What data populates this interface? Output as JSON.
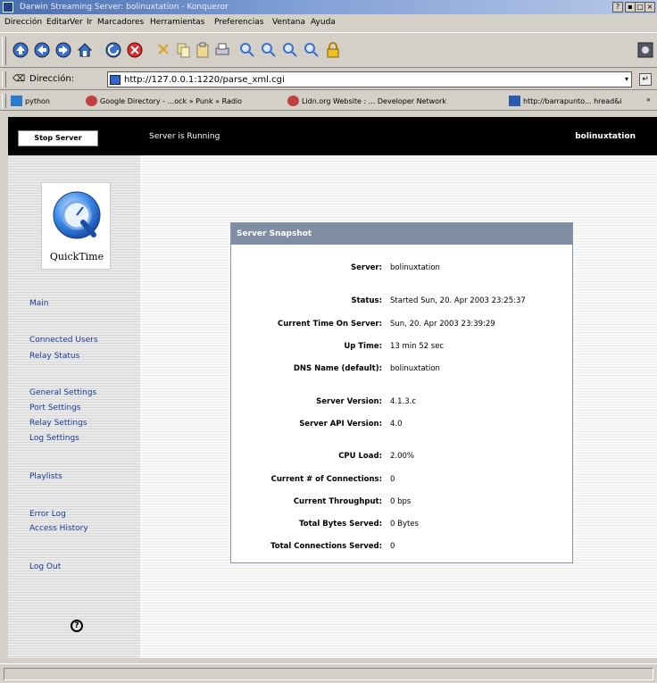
{
  "window": {
    "title": "Darwin Streaming Server: bolinuxtation - Konqueror"
  },
  "menu": [
    "Dirección",
    "Editar",
    "Ver",
    "Ir",
    "Marcadores",
    "Herramientas",
    "Preferencias",
    "Ventana",
    "Ayuda"
  ],
  "toolbar_icons": [
    "up-icon",
    "back-icon",
    "forward-icon",
    "home-icon",
    "reload-icon",
    "stop-icon",
    "cut-icon",
    "copy-icon",
    "paste-icon",
    "print-icon",
    "zoom-fit-icon",
    "zoom-in-icon",
    "zoom-out-icon",
    "zoom-icon",
    "lock-icon"
  ],
  "location": {
    "label": "Dirección:",
    "url": "http://127.0.0.1:1220/parse_xml.cgi"
  },
  "bookmarks": [
    {
      "label": "python",
      "icon": "folder-icon",
      "color": "#2a7ad0"
    },
    {
      "label": "Google Directory - ...ock » Punk » Radio",
      "icon": "page-icon",
      "color": "#c04040"
    },
    {
      "label": "Lidn.org Website : ... Developer Network",
      "icon": "page-icon",
      "color": "#c04040"
    },
    {
      "label": "http://barrapunto... hread&i",
      "icon": "page-icon",
      "color": "#2a5ab0"
    }
  ],
  "server": {
    "stop_button": "Stop Server",
    "status_text": "Server is Running",
    "hostname": "bolinuxtation"
  },
  "logo_text": "QuickTime",
  "nav": [
    {
      "label": "Main",
      "name": "nav-main"
    },
    {
      "label": "Connected Users",
      "name": "nav-connected-users"
    },
    {
      "label": "Relay Status",
      "name": "nav-relay-status"
    },
    {
      "label": "General Settings",
      "name": "nav-general-settings"
    },
    {
      "label": "Port Settings",
      "name": "nav-port-settings"
    },
    {
      "label": "Relay Settings",
      "name": "nav-relay-settings"
    },
    {
      "label": "Log Settings",
      "name": "nav-log-settings"
    },
    {
      "label": "Playlists",
      "name": "nav-playlists"
    },
    {
      "label": "Error Log",
      "name": "nav-error-log"
    },
    {
      "label": "Access History",
      "name": "nav-access-history"
    },
    {
      "label": "Log Out",
      "name": "nav-log-out"
    }
  ],
  "snapshot": {
    "title": "Server Snapshot",
    "rows": [
      {
        "label": "Server:",
        "value": "bolinuxtation"
      },
      {
        "label": "Status:",
        "value": "Started Sun, 20. Apr 2003 23:25:37"
      },
      {
        "label": "Current Time On Server:",
        "value": "Sun, 20. Apr 2003 23:39:29"
      },
      {
        "label": "Up Time:",
        "value": "13 min 52 sec"
      },
      {
        "label": "DNS Name (default):",
        "value": "bolinuxtation"
      },
      {
        "label": "Server Version:",
        "value": "4.1.3.c"
      },
      {
        "label": "Server API Version:",
        "value": "4.0"
      },
      {
        "label": "CPU Load:",
        "value": "2.00%"
      },
      {
        "label": "Current # of Connections:",
        "value": "0"
      },
      {
        "label": "Current Throughput:",
        "value": "0 bps"
      },
      {
        "label": "Total Bytes Served:",
        "value": "0 Bytes"
      },
      {
        "label": "Total Connections Served:",
        "value": "0"
      }
    ]
  },
  "colors": {
    "panel_header": "#7f8ea5",
    "nav_link": "#1a3a9a",
    "top_bar": "#000000"
  }
}
